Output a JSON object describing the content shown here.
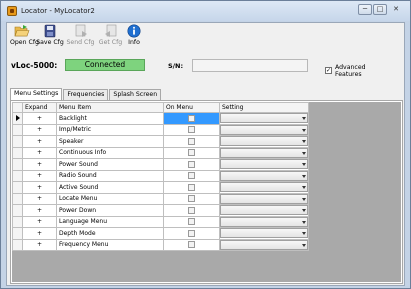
{
  "window": {
    "title": "Locator - MyLocator2",
    "buttons": [
      "─",
      "□",
      "✕"
    ]
  },
  "toolbar": {
    "open_cfg": "Open Cfg",
    "save_cfg": "Save Cfg",
    "send_cfg": "Send Cfg",
    "get_cfg": "Get Cfg",
    "info": "Info"
  },
  "status": {
    "model_label": "vLoc-5000:",
    "connection": "Connected",
    "sn_label": "S/N:",
    "sn_value": "",
    "advanced_checked": "✓",
    "advanced_line1": "Advanced",
    "advanced_line2": "Features"
  },
  "tabs": [
    "Menu Settings",
    "Frequencies",
    "Splash Screen"
  ],
  "grid": {
    "headers": [
      "Expand",
      "Menu Item",
      "On Menu",
      "Setting"
    ],
    "rows": [
      {
        "expand": "+",
        "item": "Backlight"
      },
      {
        "expand": "+",
        "item": "Imp/Metric"
      },
      {
        "expand": "+",
        "item": "Speaker"
      },
      {
        "expand": "+",
        "item": "Continuous Info"
      },
      {
        "expand": "+",
        "item": "Power Sound"
      },
      {
        "expand": "+",
        "item": "Radio Sound"
      },
      {
        "expand": "+",
        "item": "Active Sound"
      },
      {
        "expand": "+",
        "item": "Locate Menu"
      },
      {
        "expand": "+",
        "item": "Power Down"
      },
      {
        "expand": "+",
        "item": "Language Menu"
      },
      {
        "expand": "+",
        "item": "Depth Mode"
      },
      {
        "expand": "+",
        "item": "Frequency Menu"
      }
    ]
  }
}
